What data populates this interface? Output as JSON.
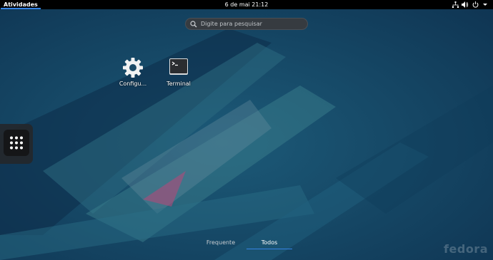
{
  "topbar": {
    "activities_label": "Atividades",
    "clock": "6 de mai  21:12",
    "status_icons": [
      "network-icon",
      "volume-icon",
      "power-icon"
    ]
  },
  "search": {
    "placeholder": "Digite para pesquisar"
  },
  "apps": [
    {
      "label": "Configu...",
      "icon": "settings-gear-icon"
    },
    {
      "label": "Terminal",
      "icon": "terminal-icon"
    }
  ],
  "dash": {
    "show_apps_icon": "app-grid-icon"
  },
  "tabs": [
    {
      "label": "Frequente",
      "active": false
    },
    {
      "label": "Todos",
      "active": true
    }
  ],
  "branding": {
    "text": "fedora"
  },
  "colors": {
    "accent": "#3584e4",
    "topbar": "#000000",
    "background": "#123f5f"
  }
}
